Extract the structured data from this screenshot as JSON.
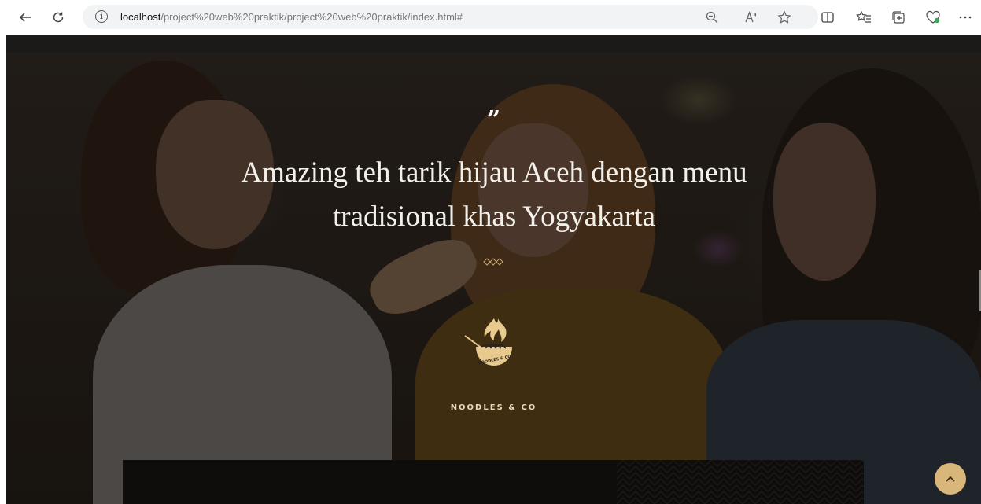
{
  "browser": {
    "url_host": "localhost",
    "url_path": "/project%20web%20praktik/project%20web%20praktik/index.html#"
  },
  "hero": {
    "quote_mark": "”",
    "headline_line1": "Amazing teh tarik hijau Aceh dengan menu",
    "headline_line2": "tradisional khas Yogyakarta",
    "logo_text": "NOODLES & CO",
    "brand_name": "NOODLES & CO"
  },
  "colors": {
    "accent_gold": "#d9b67a",
    "brand_text": "#e8d9b8",
    "page_bg": "#1a1714"
  },
  "icons": {
    "back": "back-arrow-icon",
    "refresh": "refresh-icon",
    "info": "info-icon",
    "zoom": "zoom-out-icon",
    "read_aloud": "read-aloud-icon",
    "favorite": "star-icon",
    "split": "split-screen-icon",
    "favorites": "favorites-icon",
    "collections": "collections-icon",
    "health": "browser-essentials-icon",
    "more": "more-icon",
    "scroll_top": "chevron-up-icon"
  }
}
